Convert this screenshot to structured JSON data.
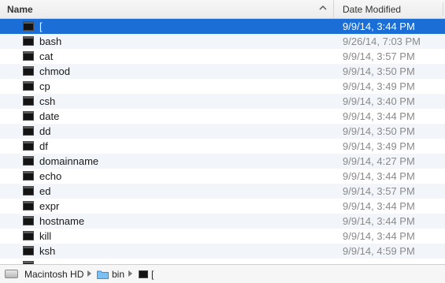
{
  "header": {
    "name_label": "Name",
    "date_label": "Date Modified",
    "sort_icon": "chevron-up-icon"
  },
  "files": [
    {
      "name": "[",
      "date": "9/9/14, 3:44 PM",
      "selected": true
    },
    {
      "name": "bash",
      "date": "9/26/14, 7:03 PM"
    },
    {
      "name": "cat",
      "date": "9/9/14, 3:57 PM"
    },
    {
      "name": "chmod",
      "date": "9/9/14, 3:50 PM"
    },
    {
      "name": "cp",
      "date": "9/9/14, 3:49 PM"
    },
    {
      "name": "csh",
      "date": "9/9/14, 3:40 PM"
    },
    {
      "name": "date",
      "date": "9/9/14, 3:44 PM"
    },
    {
      "name": "dd",
      "date": "9/9/14, 3:50 PM"
    },
    {
      "name": "df",
      "date": "9/9/14, 3:49 PM"
    },
    {
      "name": "domainname",
      "date": "9/9/14, 4:27 PM"
    },
    {
      "name": "echo",
      "date": "9/9/14, 3:44 PM"
    },
    {
      "name": "ed",
      "date": "9/9/14, 3:57 PM"
    },
    {
      "name": "expr",
      "date": "9/9/14, 3:44 PM"
    },
    {
      "name": "hostname",
      "date": "9/9/14, 3:44 PM"
    },
    {
      "name": "kill",
      "date": "9/9/14, 3:44 PM"
    },
    {
      "name": "ksh",
      "date": "9/9/14, 4:59 PM"
    },
    {
      "name": "",
      "date": ""
    }
  ],
  "pathbar": {
    "items": [
      {
        "label": "Macintosh HD",
        "icon": "hard-disk-icon"
      },
      {
        "label": "bin",
        "icon": "folder-icon"
      },
      {
        "label": "[",
        "icon": "terminal-exec-icon"
      }
    ]
  },
  "colors": {
    "selection": "#1b6ed6",
    "alt_row": "#f2f5fa",
    "date_text": "#8a8a8a"
  }
}
